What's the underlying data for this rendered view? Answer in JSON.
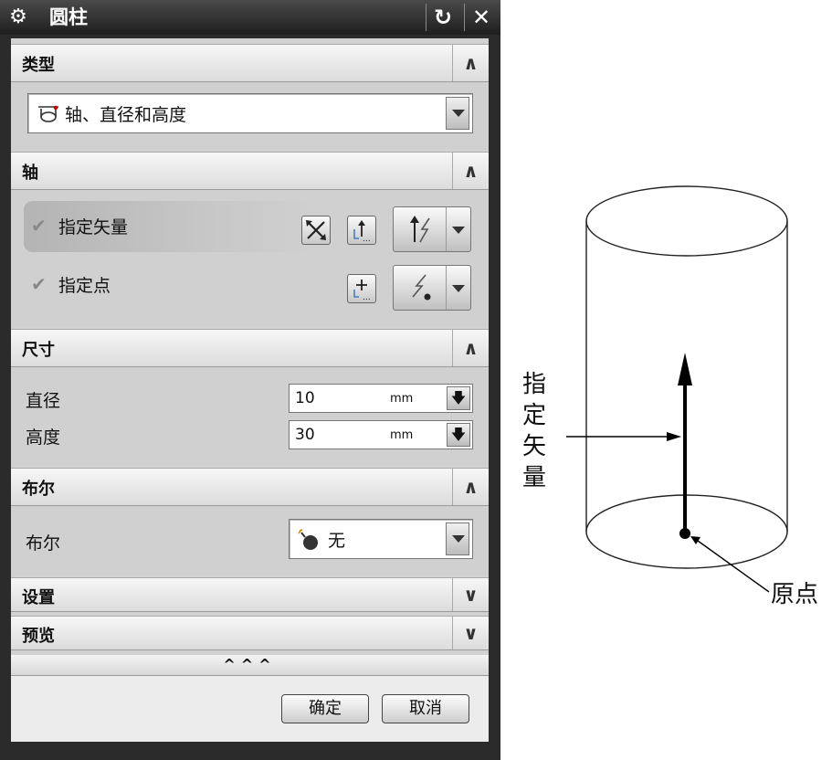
{
  "dialog": {
    "title": "圆柱",
    "reset_glyph": "↻",
    "close_glyph": "✕"
  },
  "sections": {
    "type": {
      "title": "类型",
      "toggle": "∧",
      "selected": "轴、直径和高度"
    },
    "axis": {
      "title": "轴",
      "toggle": "∧",
      "vector_label": "指定矢量",
      "point_label": "指定点"
    },
    "dimensions": {
      "title": "尺寸",
      "toggle": "∧",
      "diameter_label": "直径",
      "diameter_value": "10",
      "diameter_unit": "mm",
      "height_label": "高度",
      "height_value": "30",
      "height_unit": "mm"
    },
    "boolean": {
      "title": "布尔",
      "toggle": "∧",
      "label": "布尔",
      "selected": "无"
    },
    "settings": {
      "title": "设置",
      "toggle": "∨"
    },
    "preview": {
      "title": "预览",
      "toggle": "∨"
    }
  },
  "footer": {
    "more_glyph": "^^^",
    "ok_label": "确定",
    "cancel_label": "取消"
  },
  "figure": {
    "vector_callout": [
      "指",
      "定",
      "矢",
      "量"
    ],
    "origin_callout": "原点"
  },
  "colors": {
    "titlebar": "#2b2b2b",
    "panel": "#d2d2d2",
    "header": "#eaeaea"
  }
}
